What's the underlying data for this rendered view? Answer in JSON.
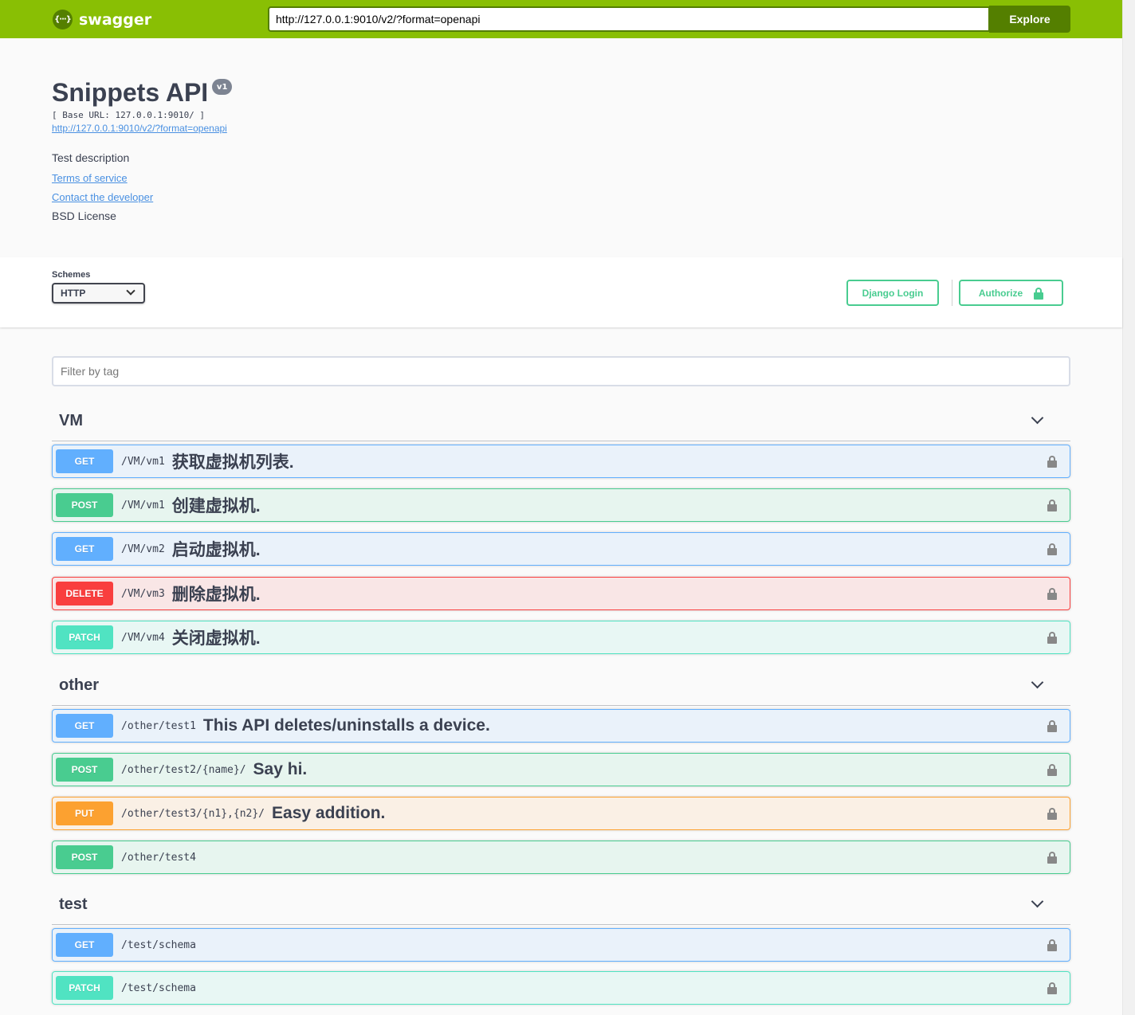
{
  "topbar": {
    "logo_text": "swagger",
    "logo_glyph": "{···}",
    "url_value": "http://127.0.0.1:9010/v2/?format=openapi",
    "explore_label": "Explore",
    "color": "#89bf04"
  },
  "info": {
    "title": "Snippets API",
    "version": "v1",
    "base_url": "[ Base URL: 127.0.0.1:9010/ ]",
    "spec_url": "http://127.0.0.1:9010/v2/?format=openapi",
    "description": "Test description",
    "terms": "Terms of service",
    "contact": "Contact the developer",
    "license": "BSD License"
  },
  "schemes": {
    "label": "Schemes",
    "selected": "HTTP",
    "django_login": "Django Login",
    "authorize": "Authorize"
  },
  "filter": {
    "placeholder": "Filter by tag"
  },
  "tags": [
    {
      "name": "VM",
      "operations": [
        {
          "method": "GET",
          "path": "/VM/vm1",
          "summary": "获取虚拟机列表."
        },
        {
          "method": "POST",
          "path": "/VM/vm1",
          "summary": "创建虚拟机."
        },
        {
          "method": "GET",
          "path": "/VM/vm2",
          "summary": "启动虚拟机."
        },
        {
          "method": "DELETE",
          "path": "/VM/vm3",
          "summary": "删除虚拟机."
        },
        {
          "method": "PATCH",
          "path": "/VM/vm4",
          "summary": "关闭虚拟机."
        }
      ]
    },
    {
      "name": "other",
      "operations": [
        {
          "method": "GET",
          "path": "/other/test1",
          "summary": "This API deletes/uninstalls a device."
        },
        {
          "method": "POST",
          "path": "/other/test2/{name}/",
          "summary": "Say hi."
        },
        {
          "method": "PUT",
          "path": "/other/test3/{n1},{n2}/",
          "summary": "Easy addition."
        },
        {
          "method": "POST",
          "path": "/other/test4",
          "summary": ""
        }
      ]
    },
    {
      "name": "test",
      "operations": [
        {
          "method": "GET",
          "path": "/test/schema",
          "summary": ""
        },
        {
          "method": "PATCH",
          "path": "/test/schema",
          "summary": ""
        }
      ]
    }
  ],
  "method_colors": {
    "GET": "#61affe",
    "POST": "#49cc90",
    "DELETE": "#f93e3e",
    "PATCH": "#50e3c2",
    "PUT": "#fca130"
  }
}
